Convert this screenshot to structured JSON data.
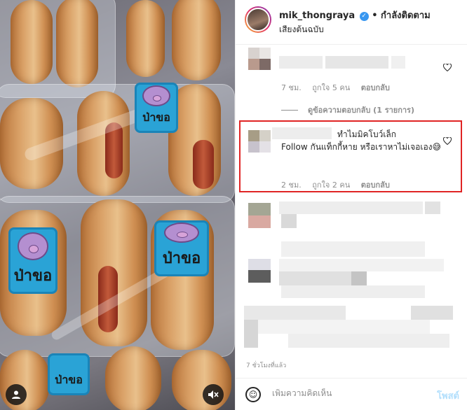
{
  "header": {
    "username": "mik_thongraya",
    "verified_glyph": "✓",
    "separator": "•",
    "follow_label": "กำลังติดตาม",
    "audio_label": "เสียงต้นฉบับ"
  },
  "photo": {
    "label_text": "ป่าขอ"
  },
  "comments": [
    {
      "id": "comment-1",
      "time": "7 ชม.",
      "likes": "ถูกใจ 5 คน",
      "reply_label": "ตอบกลับ"
    },
    {
      "id": "comment-2",
      "text_line1": "ทำไมมิคโบว์เล็ก",
      "text_rest": "Follow กันแท็กกี้หาย หรือเราหาไม่เจอเอง😅",
      "time": "2 ชม.",
      "likes": "ถูกใจ 2 คน",
      "reply_label": "ตอบกลับ"
    }
  ],
  "view_replies": "ดูข้อความตอบกลับ (1 รายการ)",
  "post_time": "7 ชั่วโมงที่แล้ว",
  "footer": {
    "emoji_glyph": "☺",
    "add_comment_placeholder": "เพิ่มความคิดเห็น",
    "post_label": "โพสต์"
  },
  "icons": {
    "heart": "heart-icon",
    "user": "user-tag-icon",
    "mute": "mute-icon",
    "emoji": "emoji-icon"
  },
  "colors": {
    "accent": "#3897f0",
    "highlight": "#e02424",
    "muted_text": "#8e8e8e",
    "post_disabled": "#b2dffc"
  }
}
